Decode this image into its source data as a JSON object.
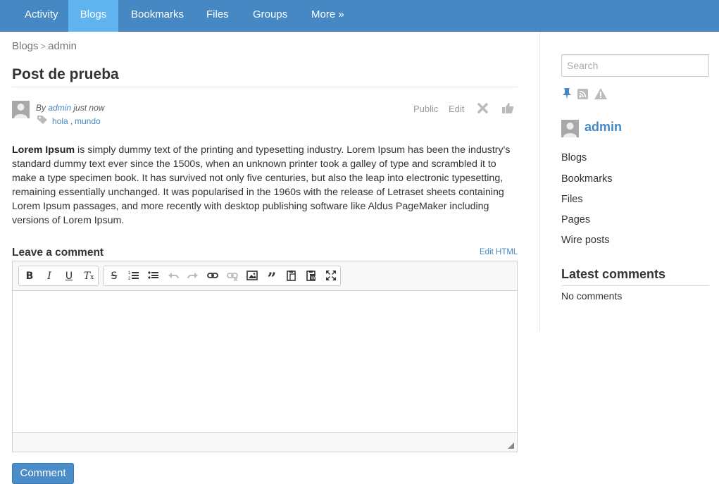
{
  "nav": {
    "items": [
      {
        "label": "Activity",
        "active": false
      },
      {
        "label": "Blogs",
        "active": true
      },
      {
        "label": "Bookmarks",
        "active": false
      },
      {
        "label": "Files",
        "active": false
      },
      {
        "label": "Groups",
        "active": false
      },
      {
        "label": "More »",
        "active": false
      }
    ]
  },
  "breadcrumb": {
    "root": "Blogs",
    "separator": ">",
    "current": "admin"
  },
  "post": {
    "title": "Post de prueba",
    "by_prefix": "By",
    "author": "admin",
    "time": "just now",
    "tags": [
      "hola",
      "mundo"
    ],
    "tag_separator": ",",
    "access": "Public",
    "edit_label": "Edit",
    "body_bold": "Lorem Ipsum",
    "body_rest": " is simply dummy text of the printing and typesetting industry. Lorem Ipsum has been the industry's standard dummy text ever since the 1500s, when an unknown printer took a galley of type and scrambled it to make a type specimen book. It has survived not only five centuries, but also the leap into electronic typesetting, remaining essentially unchanged. It was popularised in the 1960s with the release of Letraset sheets containing Lorem Ipsum passages, and more recently with desktop publishing software like Aldus PageMaker including versions of Lorem Ipsum."
  },
  "comment": {
    "title": "Leave a comment",
    "edit_html": "Edit HTML",
    "submit": "Comment"
  },
  "sidebar": {
    "search_placeholder": "Search",
    "owner": "admin",
    "links": [
      "Blogs",
      "Bookmarks",
      "Files",
      "Pages",
      "Wire posts"
    ],
    "latest_title": "Latest comments",
    "no_comments": "No comments"
  },
  "colors": {
    "nav_bg": "#4588c4",
    "nav_active": "#5fb3ee",
    "link": "#4588c4",
    "button": "#4a8dc8"
  }
}
